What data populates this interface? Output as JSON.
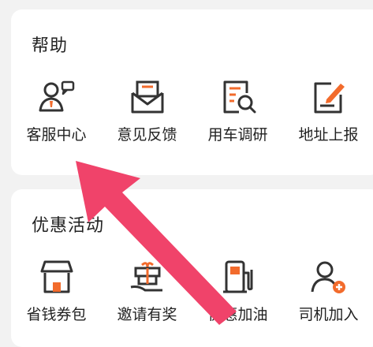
{
  "colors": {
    "accent": "#f26b2c",
    "icon": "#333333",
    "arrow": "#f0436a"
  },
  "help": {
    "title": "帮助",
    "items": [
      {
        "label": "客服中心",
        "icon": "customer-service-icon"
      },
      {
        "label": "意见反馈",
        "icon": "feedback-envelope-icon"
      },
      {
        "label": "用车调研",
        "icon": "survey-document-icon"
      },
      {
        "label": "地址上报",
        "icon": "address-report-icon"
      }
    ]
  },
  "promo": {
    "title": "优惠活动",
    "items": [
      {
        "label": "省钱券包",
        "icon": "coupon-store-icon"
      },
      {
        "label": "邀请有奖",
        "icon": "gift-invite-icon"
      },
      {
        "label": "优惠加油",
        "icon": "fuel-pump-icon"
      },
      {
        "label": "司机加入",
        "icon": "driver-join-icon"
      }
    ]
  }
}
